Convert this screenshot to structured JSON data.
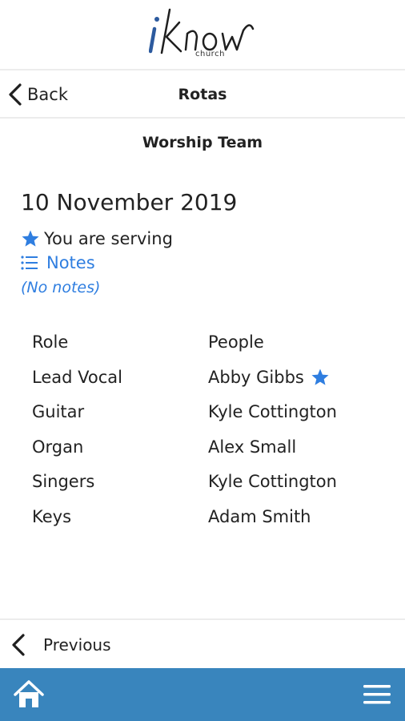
{
  "app": {
    "logo_text": "iKnow",
    "logo_subtext": "church"
  },
  "nav": {
    "back_label": "Back",
    "title": "Rotas"
  },
  "rota": {
    "team_name": "Worship Team",
    "date": "10 November 2019",
    "serving_text": "You are serving",
    "notes_label": "Notes",
    "no_notes_text": "(No notes)",
    "columns": {
      "role": "Role",
      "people": "People"
    },
    "rows": [
      {
        "role": "Lead Vocal",
        "person": "Abby Gibbs",
        "starred": true
      },
      {
        "role": "Guitar",
        "person": "Kyle Cottington",
        "starred": false
      },
      {
        "role": "Organ",
        "person": "Alex Small",
        "starred": false
      },
      {
        "role": "Singers",
        "person": "Kyle Cottington",
        "starred": false
      },
      {
        "role": "Keys",
        "person": "Adam Smith",
        "starred": false
      }
    ]
  },
  "pager": {
    "previous_label": "Previous"
  },
  "icons": {
    "back": "chevron-left-icon",
    "star": "star-icon",
    "notes": "list-icon",
    "home": "home-icon",
    "menu": "hamburger-menu-icon"
  },
  "colors": {
    "accent": "#2f7ee0",
    "tab_bar": "#3985bd",
    "logo_blue": "#2c5a9e"
  }
}
